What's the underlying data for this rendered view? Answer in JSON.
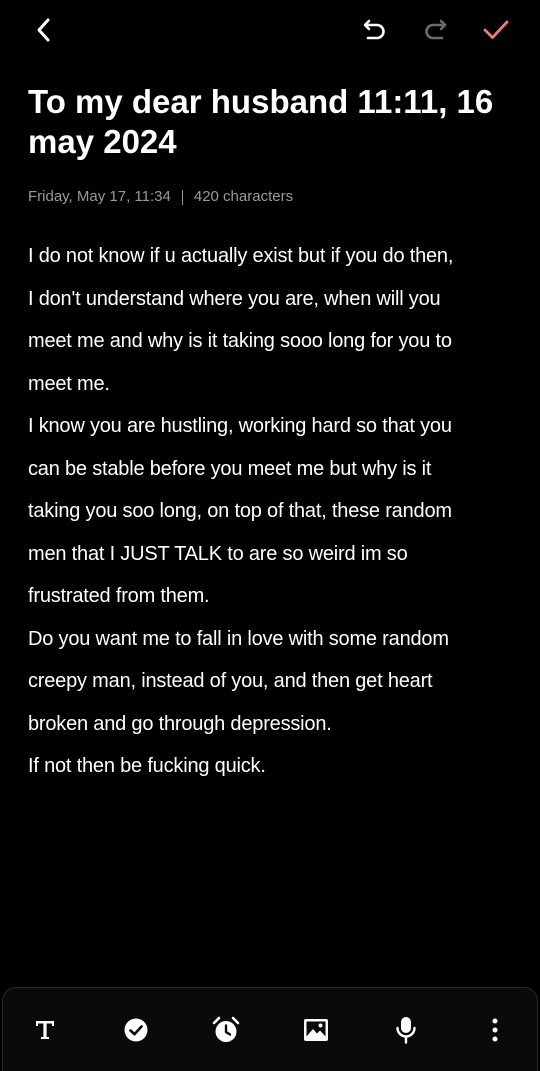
{
  "toolbar": {
    "back_icon": "chevron-left-icon",
    "undo_icon": "undo-icon",
    "redo_icon": "redo-icon",
    "done_icon": "checkmark-icon",
    "accent_color": "#ef7a7a"
  },
  "note": {
    "title": "To my dear husband 11:11, 16 may 2024",
    "date": "Friday, May 17, 11:34",
    "char_count": "420 characters",
    "lines": [
      "I do not know if u actually exist but if you do then,",
      "I  don't understand where you are, when will you",
      "meet me and why is it taking sooo long for you to",
      "meet me.",
      "I know you are hustling, working hard so that you",
      "can be stable before you meet me but why is it",
      "taking you soo long, on top of that, these random",
      "men that I JUST TALK to are so weird im so",
      "frustrated from them.",
      "Do you want me to fall in love with some random",
      "creepy man, instead of you, and then get heart",
      "broken and go through depression.",
      "If not then be fucking quick."
    ]
  },
  "bottom_toolbar": {
    "icons": [
      "text-format-icon",
      "checkbox-icon",
      "alarm-reminder-icon",
      "image-icon",
      "microphone-icon",
      "more-vertical-icon"
    ]
  }
}
